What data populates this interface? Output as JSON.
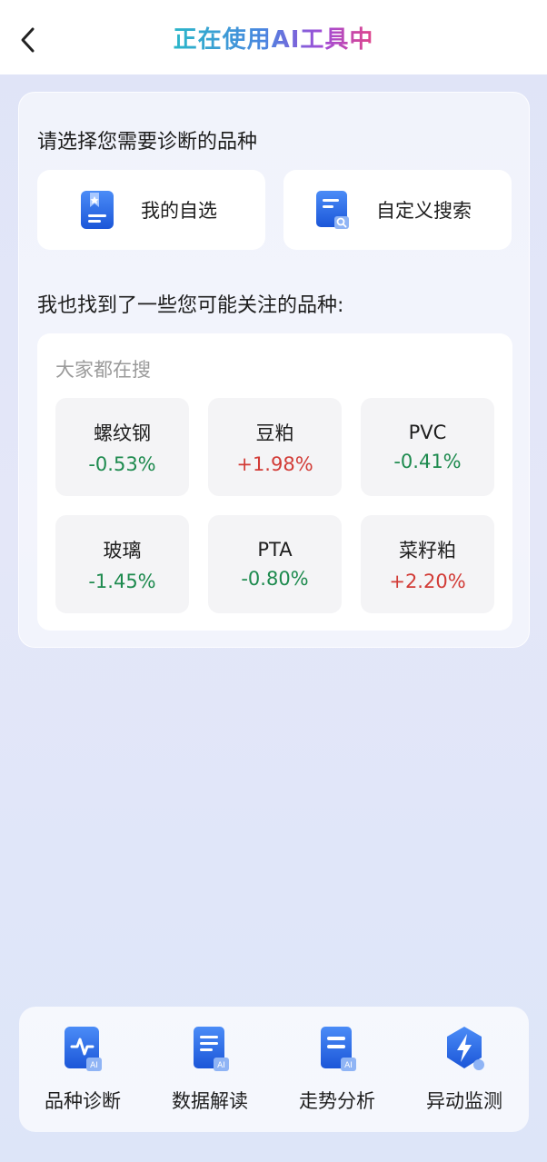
{
  "header": {
    "title": "正在使用AI工具中"
  },
  "select": {
    "title": "请选择您需要诊断的品种",
    "my_watchlist": "我的自选",
    "custom_search": "自定义搜索"
  },
  "suggest": {
    "title": "我也找到了一些您可能关注的品种:",
    "caption": "大家都在搜",
    "items": [
      {
        "name": "螺纹钢",
        "change": "-0.53%",
        "trend": "down"
      },
      {
        "name": "豆粕",
        "change": "+1.98%",
        "trend": "up"
      },
      {
        "name": "PVC",
        "change": "-0.41%",
        "trend": "down"
      },
      {
        "name": "玻璃",
        "change": "-1.45%",
        "trend": "down"
      },
      {
        "name": "PTA",
        "change": "-0.80%",
        "trend": "down"
      },
      {
        "name": "菜籽粕",
        "change": "+2.20%",
        "trend": "up"
      }
    ]
  },
  "tools": [
    {
      "label": "品种诊断",
      "icon": "pulse-ai-icon"
    },
    {
      "label": "数据解读",
      "icon": "document-ai-icon"
    },
    {
      "label": "走势分析",
      "icon": "report-ai-icon"
    },
    {
      "label": "异动监测",
      "icon": "lightning-shield-icon"
    }
  ],
  "colors": {
    "down": "#1d8a4e",
    "up": "#d23b36",
    "accent": "#1f6fe5"
  }
}
